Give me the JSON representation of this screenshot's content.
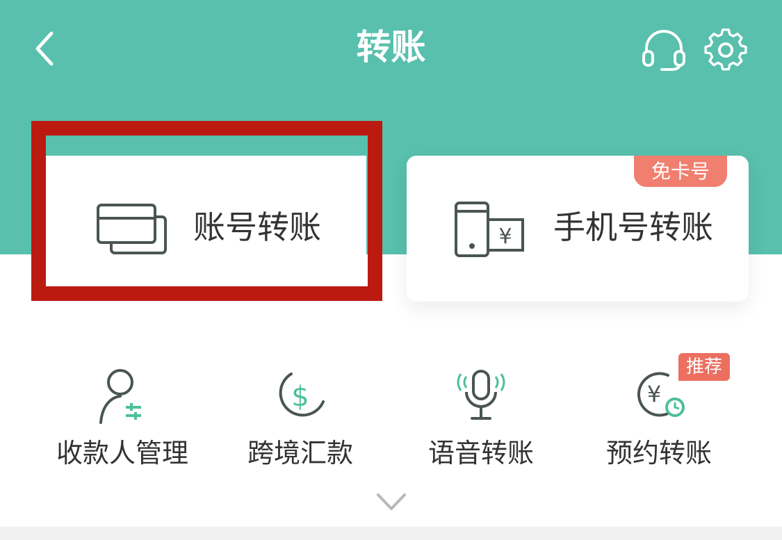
{
  "header": {
    "title": "转账",
    "back_icon": "chevron-left-icon",
    "service_icon": "headset-icon",
    "settings_icon": "gear-icon"
  },
  "cards": {
    "account_transfer": {
      "label": "账号转账",
      "icon": "bank-cards-icon"
    },
    "phone_transfer": {
      "label": "手机号转账",
      "icon": "phone-yuan-icon",
      "badge": "免卡号"
    }
  },
  "functions": [
    {
      "label": "收款人管理",
      "icon": "payee-manage-icon"
    },
    {
      "label": "跨境汇款",
      "icon": "dollar-circle-icon"
    },
    {
      "label": "语音转账",
      "icon": "microphone-icon"
    },
    {
      "label": "预约转账",
      "icon": "yuan-clock-icon",
      "badge": "推荐"
    }
  ],
  "expand_icon": "chevron-down-icon",
  "colors": {
    "header_bg": "#58c0ad",
    "highlight": "#bb1a10",
    "badge": "#ec6f5f",
    "icon_accent": "#4cbf9b",
    "icon_stroke": "#4a5553"
  }
}
